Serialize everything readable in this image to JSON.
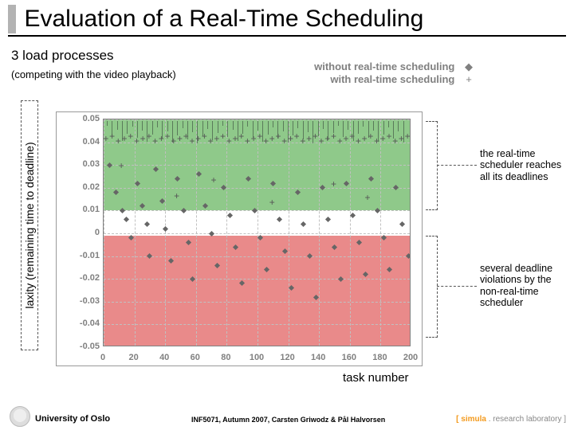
{
  "title": "Evaluation of a Real-Time Scheduling",
  "sub_heading": "3 load processes",
  "sub_note": "(competing with the video playback)",
  "legend": {
    "without": "without real-time scheduling",
    "with": "with real-time scheduling",
    "mark_without": "◆",
    "mark_with": "+"
  },
  "ylabel": "laxity (remaining time to deadline)",
  "xlabel": "task number",
  "annotations": {
    "top": "the real-time scheduler reaches all its deadlines",
    "bottom": "several deadline violations by the non-real-time scheduler"
  },
  "footer": {
    "uni": "University of Oslo",
    "course": "INF5071, Autumn 2007, Carsten Griwodz & Pål Halvorsen",
    "lab_open": "[ ",
    "lab_brand": "simula",
    "lab_rest": " . research laboratory ]"
  },
  "chart_data": {
    "type": "scatter",
    "xlabel": "task number",
    "ylabel": "laxity (remaining time to deadline)",
    "xlim": [
      0,
      200
    ],
    "ylim": [
      -0.05,
      0.05
    ],
    "xticks": [
      0,
      20,
      40,
      60,
      80,
      100,
      120,
      140,
      160,
      180,
      200
    ],
    "yticks": [
      0.05,
      0.04,
      0.03,
      0.02,
      0.01,
      0,
      -0.01,
      -0.02,
      -0.03,
      -0.04,
      -0.05
    ],
    "series": [
      {
        "name": "with real-time scheduling",
        "marker": "plus",
        "points": [
          [
            2,
            0.04
          ],
          [
            6,
            0.041
          ],
          [
            10,
            0.039
          ],
          [
            14,
            0.04
          ],
          [
            18,
            0.041
          ],
          [
            22,
            0.039
          ],
          [
            26,
            0.04
          ],
          [
            30,
            0.041
          ],
          [
            34,
            0.039
          ],
          [
            38,
            0.04
          ],
          [
            42,
            0.041
          ],
          [
            46,
            0.039
          ],
          [
            50,
            0.04
          ],
          [
            54,
            0.041
          ],
          [
            58,
            0.039
          ],
          [
            62,
            0.04
          ],
          [
            66,
            0.041
          ],
          [
            70,
            0.039
          ],
          [
            74,
            0.04
          ],
          [
            78,
            0.041
          ],
          [
            82,
            0.039
          ],
          [
            86,
            0.04
          ],
          [
            90,
            0.041
          ],
          [
            94,
            0.039
          ],
          [
            98,
            0.04
          ],
          [
            102,
            0.041
          ],
          [
            106,
            0.039
          ],
          [
            110,
            0.04
          ],
          [
            114,
            0.041
          ],
          [
            118,
            0.039
          ],
          [
            122,
            0.04
          ],
          [
            126,
            0.041
          ],
          [
            130,
            0.039
          ],
          [
            134,
            0.04
          ],
          [
            138,
            0.041
          ],
          [
            142,
            0.039
          ],
          [
            146,
            0.04
          ],
          [
            150,
            0.041
          ],
          [
            154,
            0.039
          ],
          [
            158,
            0.04
          ],
          [
            162,
            0.041
          ],
          [
            166,
            0.039
          ],
          [
            170,
            0.04
          ],
          [
            174,
            0.041
          ],
          [
            178,
            0.039
          ],
          [
            182,
            0.04
          ],
          [
            186,
            0.041
          ],
          [
            190,
            0.039
          ],
          [
            194,
            0.04
          ],
          [
            198,
            0.041
          ],
          [
            12,
            0.028
          ],
          [
            48,
            0.015
          ],
          [
            72,
            0.022
          ],
          [
            110,
            0.012
          ],
          [
            150,
            0.02
          ],
          [
            172,
            0.014
          ]
        ]
      },
      {
        "name": "without real-time scheduling",
        "marker": "diamond",
        "points": [
          [
            4,
            0.03
          ],
          [
            8,
            0.018
          ],
          [
            12,
            0.01
          ],
          [
            15,
            0.006
          ],
          [
            18,
            -0.002
          ],
          [
            22,
            0.022
          ],
          [
            25,
            0.012
          ],
          [
            28,
            0.004
          ],
          [
            30,
            -0.01
          ],
          [
            34,
            0.028
          ],
          [
            38,
            0.014
          ],
          [
            40,
            0.002
          ],
          [
            44,
            -0.012
          ],
          [
            48,
            0.024
          ],
          [
            52,
            0.01
          ],
          [
            55,
            -0.004
          ],
          [
            58,
            -0.02
          ],
          [
            62,
            0.026
          ],
          [
            66,
            0.012
          ],
          [
            70,
            0.0
          ],
          [
            74,
            -0.014
          ],
          [
            78,
            0.02
          ],
          [
            82,
            0.008
          ],
          [
            86,
            -0.006
          ],
          [
            90,
            -0.022
          ],
          [
            94,
            0.024
          ],
          [
            98,
            0.01
          ],
          [
            102,
            -0.002
          ],
          [
            106,
            -0.016
          ],
          [
            110,
            0.022
          ],
          [
            114,
            0.006
          ],
          [
            118,
            -0.008
          ],
          [
            122,
            -0.024
          ],
          [
            126,
            0.018
          ],
          [
            130,
            0.004
          ],
          [
            134,
            -0.01
          ],
          [
            138,
            -0.028
          ],
          [
            142,
            0.02
          ],
          [
            146,
            0.006
          ],
          [
            150,
            -0.006
          ],
          [
            154,
            -0.02
          ],
          [
            158,
            0.022
          ],
          [
            162,
            0.008
          ],
          [
            166,
            -0.004
          ],
          [
            170,
            -0.018
          ],
          [
            174,
            0.024
          ],
          [
            178,
            0.01
          ],
          [
            182,
            -0.002
          ],
          [
            186,
            -0.016
          ],
          [
            190,
            0.02
          ],
          [
            194,
            0.004
          ],
          [
            198,
            -0.01
          ]
        ]
      }
    ]
  }
}
